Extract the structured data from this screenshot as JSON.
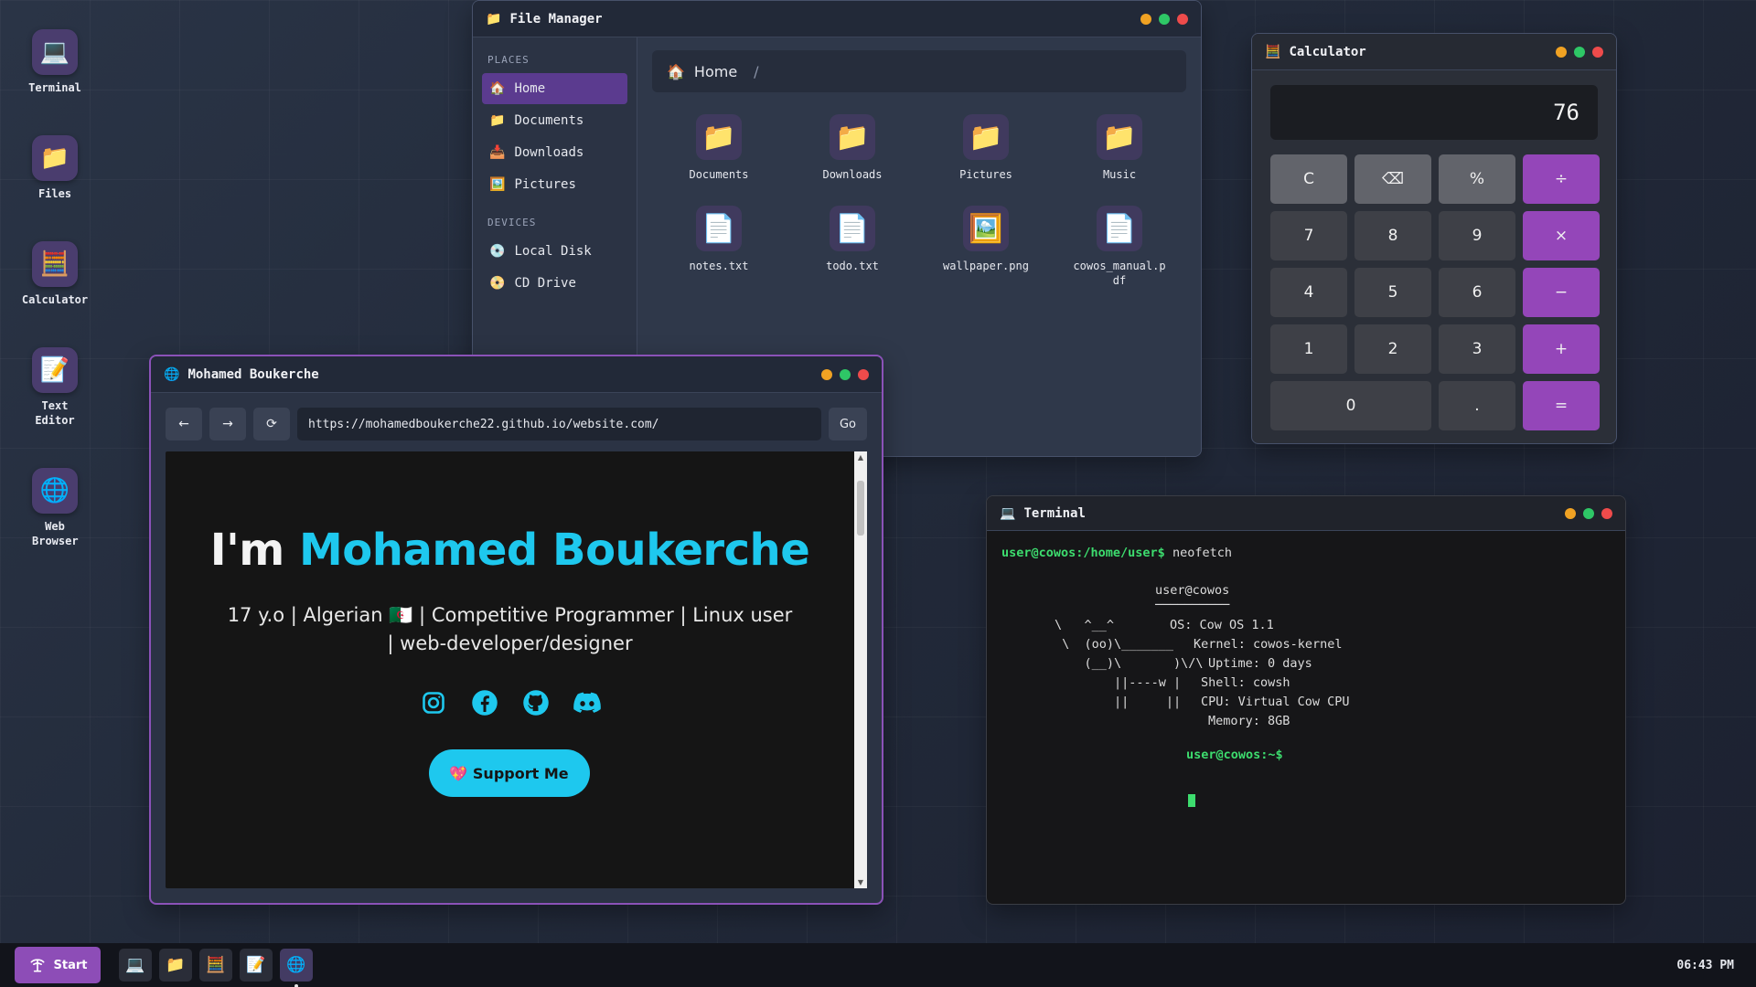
{
  "desktop": {
    "icons": [
      {
        "label": "Terminal",
        "glyph": "💻"
      },
      {
        "label": "Files",
        "glyph": "📁"
      },
      {
        "label": "Calculator",
        "glyph": "🧮"
      },
      {
        "label": "Text Editor",
        "glyph": "📝"
      },
      {
        "label": "Web Browser",
        "glyph": "🌐"
      }
    ]
  },
  "file_manager": {
    "title": "File Manager",
    "title_glyph": "📁",
    "places_header": "PLACES",
    "places": [
      {
        "label": "Home",
        "glyph": "🏠"
      },
      {
        "label": "Documents",
        "glyph": "📁"
      },
      {
        "label": "Downloads",
        "glyph": "📥"
      },
      {
        "label": "Pictures",
        "glyph": "🖼️"
      }
    ],
    "devices_header": "DEVICES",
    "devices": [
      {
        "label": "Local Disk",
        "glyph": "💿"
      },
      {
        "label": "CD Drive",
        "glyph": "📀"
      }
    ],
    "breadcrumb": {
      "glyph": "🏠",
      "label": "Home",
      "separator": "/"
    },
    "files": [
      {
        "name": "Documents",
        "glyph": "📁"
      },
      {
        "name": "Downloads",
        "glyph": "📁"
      },
      {
        "name": "Pictures",
        "glyph": "📁"
      },
      {
        "name": "Music",
        "glyph": "📁"
      },
      {
        "name": "notes.txt",
        "glyph": "📄"
      },
      {
        "name": "todo.txt",
        "glyph": "📄"
      },
      {
        "name": "wallpaper.png",
        "glyph": "🖼️"
      },
      {
        "name": "cowos_manual.pdf",
        "glyph": "📄"
      }
    ]
  },
  "calculator": {
    "title": "Calculator",
    "title_glyph": "🧮",
    "display": "76",
    "keys": [
      "C",
      "⌫",
      "%",
      "÷",
      "7",
      "8",
      "9",
      "×",
      "4",
      "5",
      "6",
      "−",
      "1",
      "2",
      "3",
      "+",
      "0",
      ".",
      "="
    ]
  },
  "browser": {
    "title": "Mohamed Boukerche",
    "title_glyph": "🌐",
    "back_label": "←",
    "forward_label": "→",
    "reload_label": "⟳",
    "url": "https://mohamedboukerche22.github.io/website.com/",
    "go_label": "Go",
    "page": {
      "title_prefix": "I'm",
      "title_name": "Mohamed Boukerche",
      "subtitle": "17 y.o | Algerian 🇩🇿 | Competitive Programmer | Linux user | web-developer/designer",
      "socials": [
        "instagram-icon",
        "facebook-icon",
        "github-icon",
        "discord-icon"
      ],
      "support_label": "💖 Support Me"
    }
  },
  "terminal": {
    "title": "Terminal",
    "title_glyph": "💻",
    "prompt1": "user@cowos:/home/user$",
    "command1": " neofetch",
    "neofetch": {
      "header": "user@cowos",
      "underline": "──────────",
      "art": [
        "\\   ^__^",
        " \\  (oo)\\_______",
        "    (__)\\       )\\/\\",
        "        ||----w |",
        "        ||     ||"
      ],
      "info": [
        "OS: Cow OS 1.1",
        "Kernel: cowos-kernel",
        "Uptime: 0 days",
        "Shell: cowsh",
        "CPU: Virtual Cow CPU",
        "Memory: 8GB"
      ]
    },
    "prompt2": "user@cowos:~$"
  },
  "taskbar": {
    "start_label": "Start",
    "tasks": [
      "💻",
      "📁",
      "🧮",
      "📝",
      "🌐"
    ],
    "clock": "06:43 PM"
  },
  "colors": {
    "accent_purple": "#8d4db7",
    "accent_cyan": "#1ec8ee",
    "terminal_green": "#3ddc6e"
  }
}
